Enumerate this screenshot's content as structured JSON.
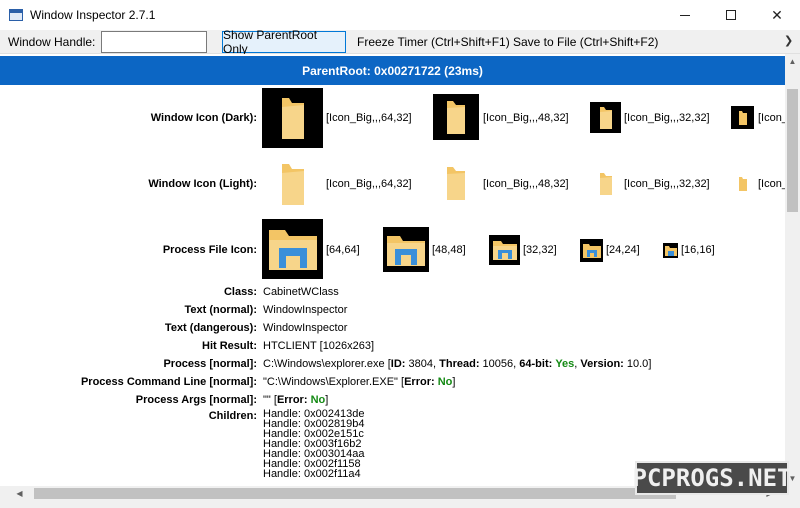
{
  "window": {
    "title": "Window Inspector 2.7.1",
    "minimize_glyph": "—",
    "maximize_glyph": "☐",
    "close_glyph": "✕"
  },
  "toolbar": {
    "handle_label": "Window Handle:",
    "handle_value": "",
    "show_parentroot_label": "Show ParentRoot Only",
    "freeze_timer_label": "Freeze Timer (Ctrl+Shift+F1)",
    "save_to_file_label": "Save to File (Ctrl+Shift+F2)",
    "overflow_glyph": "❯"
  },
  "header": {
    "title": "ParentRoot: 0x00271722 (23ms)"
  },
  "icons_dark": {
    "label": "Window Icon (Dark):",
    "items": [
      "[Icon_Big,,,64,32]",
      "[Icon_Big,,,48,32]",
      "[Icon_Big,,,32,32]",
      "[Icon_"
    ]
  },
  "icons_light": {
    "label": "Window Icon (Light):",
    "items": [
      "[Icon_Big,,,64,32]",
      "[Icon_Big,,,48,32]",
      "[Icon_Big,,,32,32]",
      "[Icon_"
    ]
  },
  "process_icon": {
    "label": "Process File Icon:",
    "items": [
      "[64,64]",
      "[48,48]",
      "[32,32]",
      "[24,24]",
      "[16,16]"
    ]
  },
  "props": {
    "class_label": "Class:",
    "class_value": "CabinetWClass",
    "text_normal_label": "Text (normal):",
    "text_normal_value": "WindowInspector",
    "text_dangerous_label": "Text (dangerous):",
    "text_dangerous_value": "WindowInspector",
    "hit_result_label": "Hit Result:",
    "hit_result_value": "HTCLIENT [1026x263]",
    "process_label": "Process [normal]:",
    "process_path": "C:\\Windows\\explorer.exe",
    "process_id_key": "ID:",
    "process_id": "3804",
    "process_thread_key": "Thread:",
    "process_thread": "10056",
    "process_64bit_key": "64-bit:",
    "process_64bit": "Yes",
    "process_version_key": "Version:",
    "process_version": "10.0",
    "cmdline_label": "Process Command Line [normal]:",
    "cmdline_value": "\"C:\\Windows\\Explorer.EXE\"",
    "cmdline_error_key": "Error:",
    "cmdline_error": "No",
    "args_label": "Process Args [normal]:",
    "args_value": "\"\"",
    "args_error_key": "Error:",
    "args_error": "No",
    "children_label": "Children:",
    "children": [
      "Handle: 0x002413de",
      "Handle: 0x002819b4",
      "Handle: 0x002e151c",
      "Handle: 0x003f16b2",
      "Handle: 0x003014aa",
      "Handle: 0x002f1158",
      "Handle: 0x002f11a4"
    ]
  },
  "scroll": {
    "up": "▲",
    "down": "▼",
    "left": "◀",
    "right": "▶",
    "vertical_position": 0.08,
    "horizontal_position": 0.0
  },
  "watermark": "PCPROGS.NET",
  "colors": {
    "header_bg": "#0c66c4",
    "accent_green": "#148a14",
    "folder_yellow": "#f3c565",
    "explorer_blue": "#3a8fd9"
  }
}
